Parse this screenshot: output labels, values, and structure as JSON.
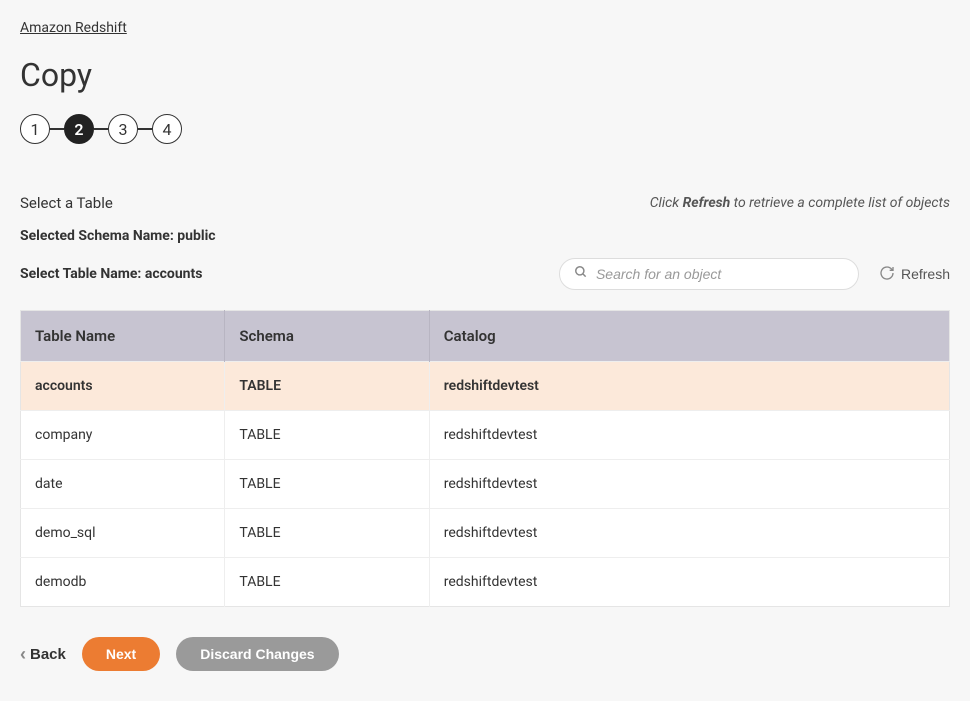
{
  "breadcrumb": "Amazon Redshift",
  "page_title": "Copy",
  "stepper": {
    "steps": [
      "1",
      "2",
      "3",
      "4"
    ],
    "active_index": 1
  },
  "labels": {
    "select_table": "Select a Table",
    "refresh_hint_prefix": "Click ",
    "refresh_hint_bold": "Refresh",
    "refresh_hint_suffix": " to retrieve a complete list of objects",
    "schema_line_prefix": "Selected Schema Name: ",
    "schema_name": "public",
    "table_line_prefix": "Select Table Name: ",
    "table_name": "accounts",
    "search_placeholder": "Search for an object",
    "refresh_button": "Refresh"
  },
  "table": {
    "headers": {
      "name": "Table Name",
      "schema": "Schema",
      "catalog": "Catalog"
    },
    "rows": [
      {
        "name": "accounts",
        "schema": "TABLE",
        "catalog": "redshiftdevtest",
        "selected": true
      },
      {
        "name": "company",
        "schema": "TABLE",
        "catalog": "redshiftdevtest",
        "selected": false
      },
      {
        "name": "date",
        "schema": "TABLE",
        "catalog": "redshiftdevtest",
        "selected": false
      },
      {
        "name": "demo_sql",
        "schema": "TABLE",
        "catalog": "redshiftdevtest",
        "selected": false
      },
      {
        "name": "demodb",
        "schema": "TABLE",
        "catalog": "redshiftdevtest",
        "selected": false
      }
    ]
  },
  "footer": {
    "back": "Back",
    "next": "Next",
    "discard": "Discard Changes"
  }
}
